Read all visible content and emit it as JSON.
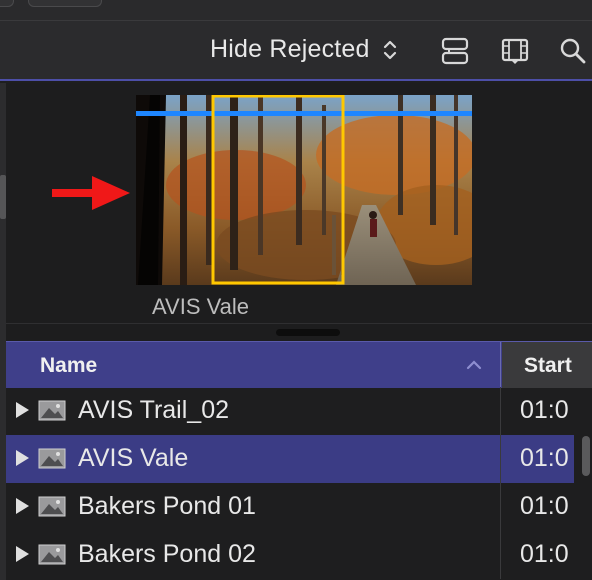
{
  "toolbar": {
    "filter_label": "Hide Rejected",
    "icons": [
      "stepper-icon",
      "clip-appearance-icon",
      "filmstrip-icon",
      "search-icon"
    ]
  },
  "browser": {
    "clip_label": "AVIS Vale",
    "annotation": "red-arrow",
    "thumbnail_overlays": {
      "blue_range_line_color": "#1e86ff",
      "yellow_selection_color": "#ffc800"
    }
  },
  "list": {
    "columns": {
      "name": "Name",
      "start": "Start"
    },
    "rows": [
      {
        "name": "AVIS Trail_02",
        "start": "01:0",
        "selected": false
      },
      {
        "name": "AVIS Vale",
        "start": "01:0",
        "selected": true
      },
      {
        "name": "Bakers Pond 01",
        "start": "01:0",
        "selected": false
      },
      {
        "name": "Bakers Pond 02",
        "start": "01:0",
        "selected": false
      }
    ]
  },
  "colors": {
    "accent": "#4d4fa8",
    "selection": "#3b3c85",
    "header": "#3f3f8a"
  }
}
